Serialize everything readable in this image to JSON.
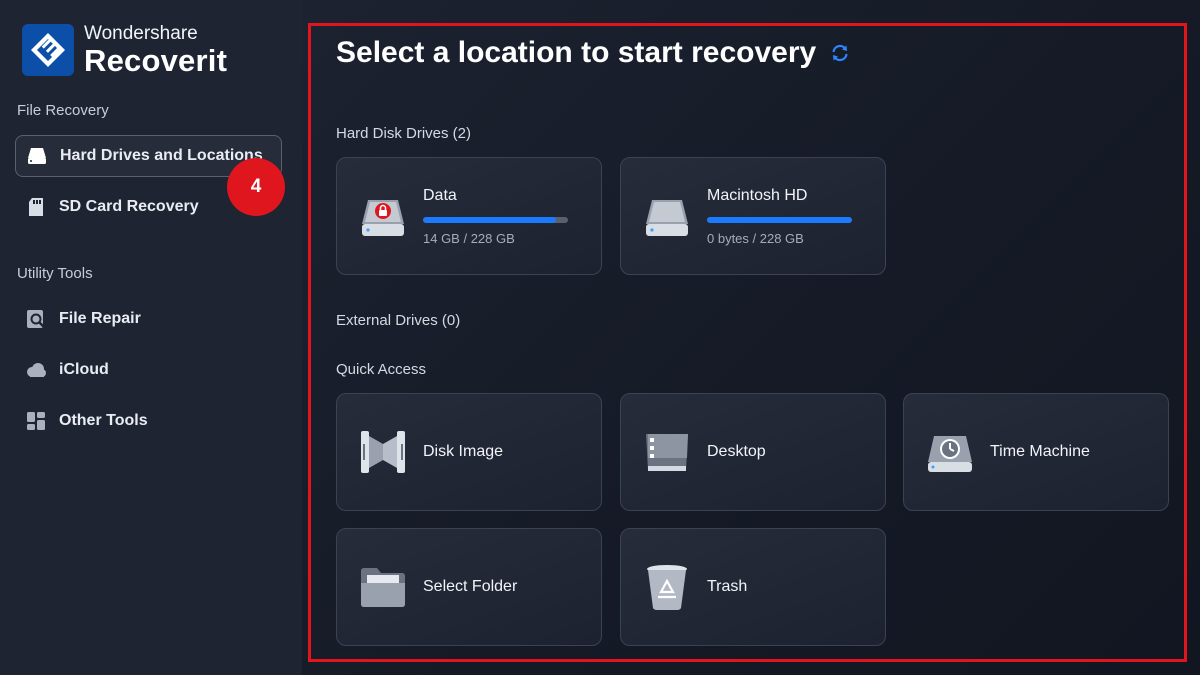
{
  "brand": {
    "company": "Wondershare",
    "product": "Recoverit"
  },
  "sidebar": {
    "sections": [
      {
        "label": "File Recovery"
      },
      {
        "label": "Utility Tools"
      }
    ],
    "items": [
      {
        "label": "Hard Drives and Locations",
        "icon": "hard-drive-icon",
        "active": true
      },
      {
        "label": "SD Card Recovery",
        "icon": "sd-card-icon"
      },
      {
        "label": "File Repair",
        "icon": "file-repair-icon"
      },
      {
        "label": "iCloud",
        "icon": "cloud-icon"
      },
      {
        "label": "Other Tools",
        "icon": "grid-tools-icon"
      }
    ]
  },
  "step_badge": "4",
  "main": {
    "title": "Select a location to start recovery",
    "refresh_icon": "refresh-icon",
    "groups": {
      "hard_disk": "Hard Disk Drives (2)",
      "external": "External Drives (0)",
      "quick_access": "Quick Access"
    },
    "drives": [
      {
        "name": "Data",
        "usage": "14 GB / 228 GB",
        "fill_percent": 92,
        "locked": true
      },
      {
        "name": "Macintosh HD",
        "usage": "0 bytes / 228 GB",
        "fill_percent": 100,
        "locked": false
      }
    ],
    "quick_access": [
      {
        "label": "Disk Image",
        "icon": "disk-image-icon"
      },
      {
        "label": "Desktop",
        "icon": "desktop-icon"
      },
      {
        "label": "Time Machine",
        "icon": "time-machine-icon"
      },
      {
        "label": "Select Folder",
        "icon": "folder-icon"
      },
      {
        "label": "Trash",
        "icon": "trash-icon"
      }
    ]
  },
  "colors": {
    "accent": "#1b7bff",
    "highlight": "#e3151c",
    "badge": "#e0161e",
    "sidebar_bg": "#1f2432"
  }
}
